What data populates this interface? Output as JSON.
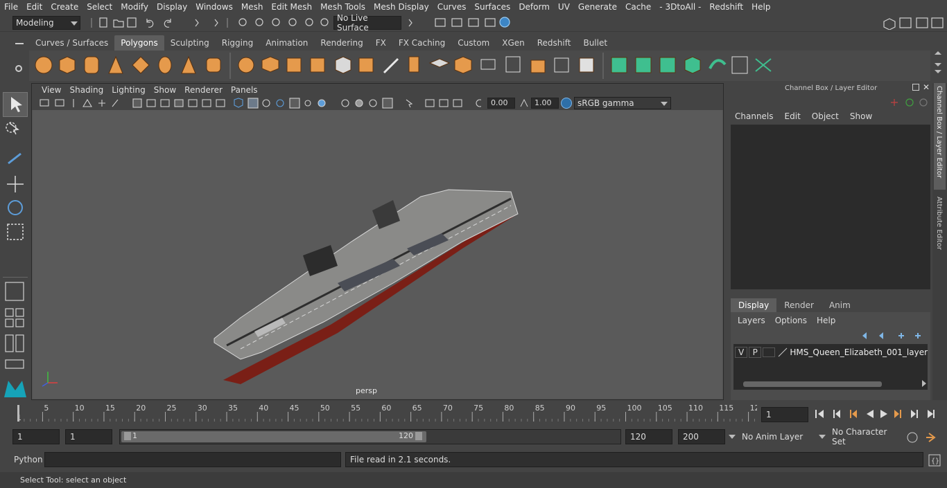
{
  "menubar": {
    "items": [
      "File",
      "Edit",
      "Create",
      "Select",
      "Modify",
      "Display",
      "Windows",
      "Mesh",
      "Edit Mesh",
      "Mesh Tools",
      "Mesh Display",
      "Curves",
      "Surfaces",
      "Deform",
      "UV",
      "Generate",
      "Cache",
      "- 3DtoAll -",
      "Redshift",
      "Help"
    ]
  },
  "statusline": {
    "mode": "Modeling",
    "live_surface": "No Live Surface"
  },
  "shelf": {
    "tabs": [
      "Curves / Surfaces",
      "Polygons",
      "Sculpting",
      "Rigging",
      "Animation",
      "Rendering",
      "FX",
      "FX Caching",
      "Custom",
      "XGen",
      "Redshift",
      "Bullet"
    ],
    "active_tab": "Polygons"
  },
  "viewport": {
    "menu": [
      "View",
      "Shading",
      "Lighting",
      "Show",
      "Renderer",
      "Panels"
    ],
    "exposure": "0.00",
    "gamma": "1.00",
    "colorspace": "sRGB gamma",
    "camera_label": "persp"
  },
  "channel_box": {
    "title": "Channel Box / Layer Editor",
    "menu": [
      "Channels",
      "Edit",
      "Object",
      "Show"
    ],
    "side_tabs": [
      "Channel Box / Layer Editor",
      "Attribute Editor"
    ]
  },
  "layer_editor": {
    "tabs": [
      "Display",
      "Render",
      "Anim"
    ],
    "active_tab": "Display",
    "menu": [
      "Layers",
      "Options",
      "Help"
    ],
    "layers": [
      {
        "visible": "V",
        "playback": "P",
        "name": "HMS_Queen_Elizabeth_001_layer"
      }
    ]
  },
  "timeline": {
    "ticks": [
      "1",
      "5",
      "10",
      "15",
      "20",
      "25",
      "30",
      "35",
      "40",
      "45",
      "50",
      "55",
      "60",
      "65",
      "70",
      "75",
      "80",
      "85",
      "90",
      "95",
      "100",
      "105",
      "110",
      "115",
      "12"
    ],
    "current_frame": "1"
  },
  "range": {
    "start": "1",
    "playback_start": "1",
    "slider_start": "1",
    "slider_end": "120",
    "playback_end": "120",
    "end": "200",
    "anim_layer": "No Anim Layer",
    "character_set": "No Character Set"
  },
  "command_line": {
    "language": "Python",
    "result": "File read in  2.1 seconds."
  },
  "help_line": {
    "text": "Select Tool: select an object"
  },
  "colors": {
    "accent": "#5d9dd9",
    "hull_red": "#7a1f16",
    "deck_grey": "#8a8a88"
  }
}
